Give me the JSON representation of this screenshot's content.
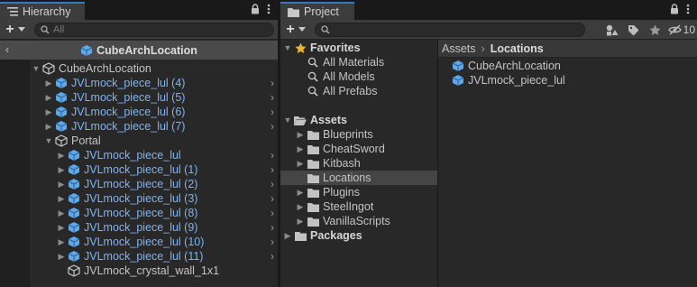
{
  "hierarchy": {
    "tab_title": "Hierarchy",
    "add_label": "+",
    "search_placeholder": "All",
    "scene_title": "CubeArchLocation",
    "rows": [
      {
        "label": "CubeArchLocation",
        "depth": 0,
        "arrow": "open",
        "icon": "gameobject-icon",
        "prefab": false,
        "chev": false
      },
      {
        "label": "JVLmock_piece_lul (4)",
        "depth": 1,
        "arrow": "closed",
        "icon": "prefab-cube-icon",
        "prefab": true,
        "chev": true
      },
      {
        "label": "JVLmock_piece_lul (5)",
        "depth": 1,
        "arrow": "closed",
        "icon": "prefab-cube-icon",
        "prefab": true,
        "chev": true
      },
      {
        "label": "JVLmock_piece_lul (6)",
        "depth": 1,
        "arrow": "closed",
        "icon": "prefab-cube-icon",
        "prefab": true,
        "chev": true
      },
      {
        "label": "JVLmock_piece_lul (7)",
        "depth": 1,
        "arrow": "closed",
        "icon": "prefab-cube-icon",
        "prefab": true,
        "chev": true
      },
      {
        "label": "Portal",
        "depth": 1,
        "arrow": "open",
        "icon": "gameobject-icon",
        "prefab": false,
        "chev": false
      },
      {
        "label": "JVLmock_piece_lul",
        "depth": 2,
        "arrow": "closed",
        "icon": "prefab-cube-icon",
        "prefab": true,
        "chev": true
      },
      {
        "label": "JVLmock_piece_lul (1)",
        "depth": 2,
        "arrow": "closed",
        "icon": "prefab-cube-icon",
        "prefab": true,
        "chev": true
      },
      {
        "label": "JVLmock_piece_lul (2)",
        "depth": 2,
        "arrow": "closed",
        "icon": "prefab-cube-icon",
        "prefab": true,
        "chev": true
      },
      {
        "label": "JVLmock_piece_lul (3)",
        "depth": 2,
        "arrow": "closed",
        "icon": "prefab-cube-icon",
        "prefab": true,
        "chev": true
      },
      {
        "label": "JVLmock_piece_lul (8)",
        "depth": 2,
        "arrow": "closed",
        "icon": "prefab-cube-icon",
        "prefab": true,
        "chev": true
      },
      {
        "label": "JVLmock_piece_lul (9)",
        "depth": 2,
        "arrow": "closed",
        "icon": "prefab-cube-icon",
        "prefab": true,
        "chev": true
      },
      {
        "label": "JVLmock_piece_lul (10)",
        "depth": 2,
        "arrow": "closed",
        "icon": "prefab-cube-icon",
        "prefab": true,
        "chev": true
      },
      {
        "label": "JVLmock_piece_lul (11)",
        "depth": 2,
        "arrow": "closed",
        "icon": "prefab-cube-icon",
        "prefab": true,
        "chev": true
      },
      {
        "label": "JVLmock_crystal_wall_1x1",
        "depth": 2,
        "arrow": "none",
        "icon": "gameobject-icon",
        "prefab": false,
        "chev": false
      }
    ]
  },
  "project": {
    "tab_title": "Project",
    "add_label": "+",
    "hidden_count": "10",
    "tree": [
      {
        "label": "Favorites",
        "depth": 0,
        "arrow": "open",
        "icon": "star-icon",
        "bold": true
      },
      {
        "label": "All Materials",
        "depth": 1,
        "arrow": "none",
        "icon": "search-icon",
        "bold": false
      },
      {
        "label": "All Models",
        "depth": 1,
        "arrow": "none",
        "icon": "search-icon",
        "bold": false
      },
      {
        "label": "All Prefabs",
        "depth": 1,
        "arrow": "none",
        "icon": "search-icon",
        "bold": false
      },
      {
        "label": "",
        "depth": 0,
        "arrow": "spacer",
        "icon": "",
        "bold": false
      },
      {
        "label": "Assets",
        "depth": 0,
        "arrow": "open",
        "icon": "folder-open-icon",
        "bold": true
      },
      {
        "label": "Blueprints",
        "depth": 1,
        "arrow": "closed",
        "icon": "folder-icon",
        "bold": false
      },
      {
        "label": "CheatSword",
        "depth": 1,
        "arrow": "closed",
        "icon": "folder-icon",
        "bold": false
      },
      {
        "label": "Kitbash",
        "depth": 1,
        "arrow": "closed",
        "icon": "folder-icon",
        "bold": false
      },
      {
        "label": "Locations",
        "depth": 1,
        "arrow": "none",
        "icon": "folder-icon",
        "bold": false,
        "selected": true
      },
      {
        "label": "Plugins",
        "depth": 1,
        "arrow": "closed",
        "icon": "folder-icon",
        "bold": false
      },
      {
        "label": "SteelIngot",
        "depth": 1,
        "arrow": "closed",
        "icon": "folder-icon",
        "bold": false
      },
      {
        "label": "VanillaScripts",
        "depth": 1,
        "arrow": "closed",
        "icon": "folder-icon",
        "bold": false
      },
      {
        "label": "Packages",
        "depth": 0,
        "arrow": "closed",
        "icon": "folder-icon",
        "bold": true
      }
    ],
    "breadcrumb": {
      "root": "Assets",
      "current": "Locations"
    },
    "files": [
      {
        "label": "CubeArchLocation",
        "icon": "prefab-cube-icon"
      },
      {
        "label": "JVLmock_piece_lul",
        "icon": "prefab-cube-icon"
      }
    ]
  },
  "colors": {
    "prefab_text": "#7fb2f2",
    "accent": "#3a79bb",
    "prefab_icon": "#5ea7e8"
  }
}
